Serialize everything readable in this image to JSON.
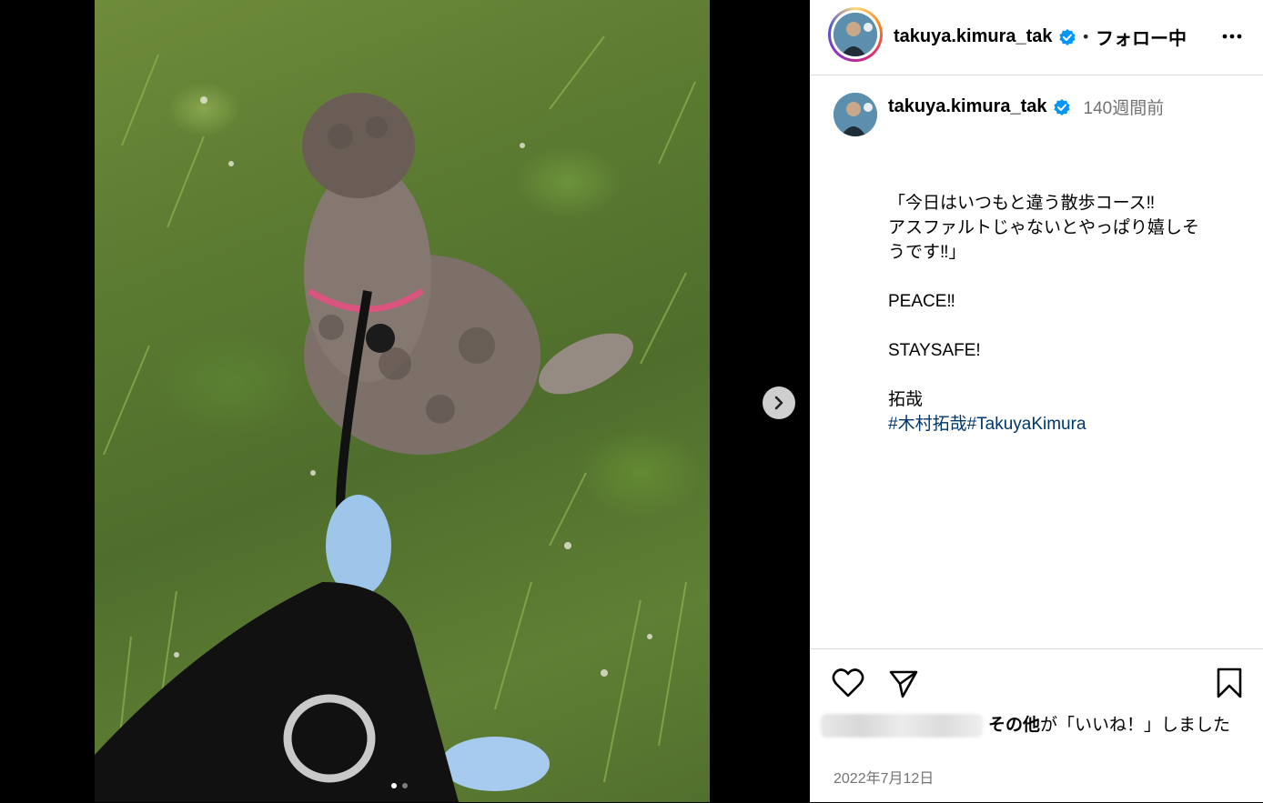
{
  "post": {
    "username": "takuya.kimura_tak",
    "verified": true,
    "separator": "•",
    "follow_status": "フォロー中",
    "time_ago": "140週間前",
    "caption_lines": [
      "「今日はいつもと違う散歩コース‼︎",
      "アスファルトじゃないとやっぱり嬉しそ",
      "うです‼︎」"
    ],
    "peace": "PEACE‼︎",
    "staysafe": "STAYSAFE!",
    "signature": "拓哉",
    "hashtags": "#木村拓哉#TakuyaKimura",
    "likes_bold": "その他",
    "likes_rest": "が「いいね！」しました",
    "date": "2022年7月12日"
  },
  "carousel": {
    "total": 2,
    "current": 1
  },
  "icons": {
    "more": "more-icon",
    "like": "heart-icon",
    "share": "send-icon",
    "save": "bookmark-icon",
    "next": "chevron-right-icon",
    "verified": "verified-badge-icon"
  },
  "colors": {
    "verified": "#0095f6",
    "hashtag": "#00376b",
    "muted": "#737373"
  }
}
